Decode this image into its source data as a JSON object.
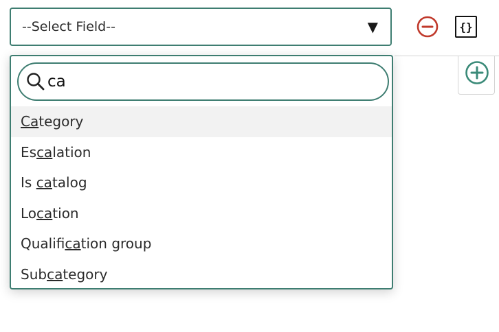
{
  "field_select": {
    "selected_value": "--Select Field--",
    "caret": "▼"
  },
  "actions": {
    "script_icon_glyph": "{}"
  },
  "search": {
    "value": "ca",
    "placeholder": ""
  },
  "options": [
    {
      "before": "",
      "match": "Ca",
      "after": "tegory",
      "highlighted": true
    },
    {
      "before": "Es",
      "match": "ca",
      "after": "lation",
      "highlighted": false
    },
    {
      "before": "Is ",
      "match": "ca",
      "after": "talog",
      "highlighted": false
    },
    {
      "before": "Lo",
      "match": "ca",
      "after": "tion",
      "highlighted": false
    },
    {
      "before": "Qualifi",
      "match": "ca",
      "after": "tion group",
      "highlighted": false
    },
    {
      "before": "Sub",
      "match": "ca",
      "after": "tegory",
      "highlighted": false
    }
  ],
  "colors": {
    "accent_border": "#3e7d71",
    "remove_red": "#c0392b",
    "add_green": "#3a8a78",
    "highlight_bg": "#f2f2f2"
  }
}
